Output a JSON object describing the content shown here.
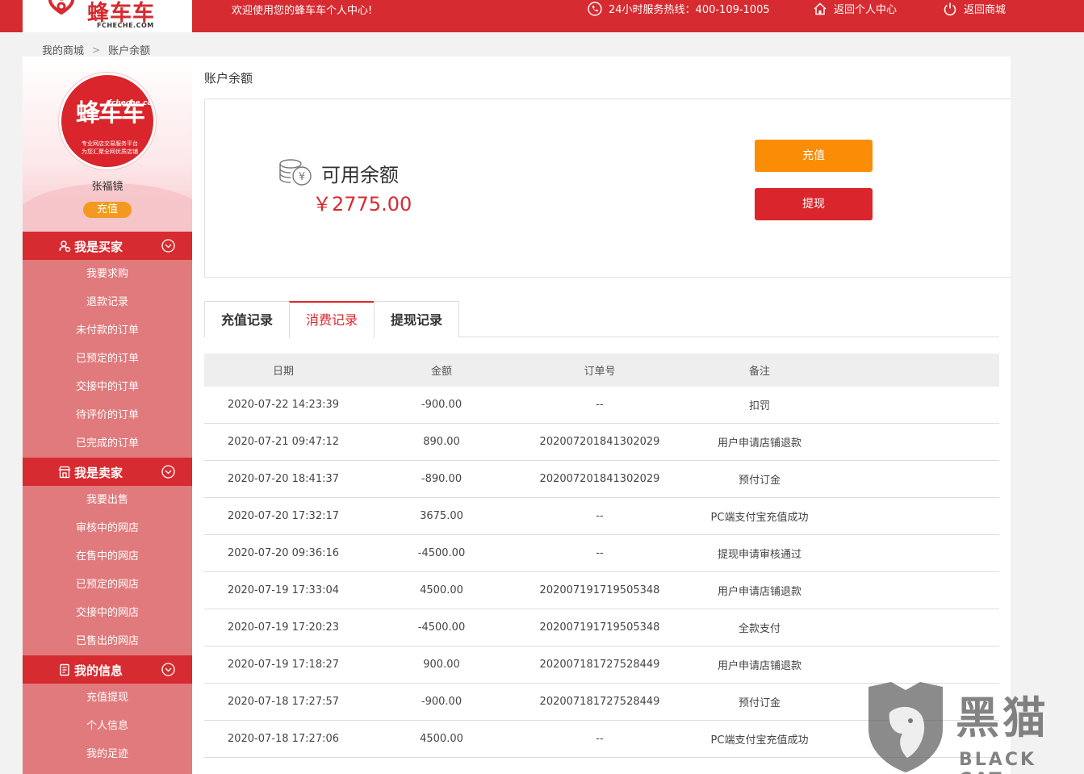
{
  "header": {
    "logo_text": "蜂车车",
    "logo_sub": "FCHECHE.COM",
    "welcome": "欢迎使用您的蜂车车个人中心!",
    "hotline": "24小时服务热线：400-109-1005",
    "back_center": "返回个人中心",
    "back_mall": "返回商城"
  },
  "breadcrumb": {
    "home": "我的商城",
    "separator": ">",
    "current": "账户余额"
  },
  "profile": {
    "avatar_text": "蜂车车",
    "avatar_domain": "fcheche.com",
    "avatar_line1": "专业网店交易服务平台",
    "avatar_line2": "为您汇聚全网优质店铺",
    "username": "张福镜",
    "recharge_label": "充值"
  },
  "sidebar": {
    "sections": [
      {
        "title": "我是买家",
        "items": [
          "我要求购",
          "退款记录",
          "未付款的订单",
          "已预定的订单",
          "交接中的订单",
          "待评价的订单",
          "已完成的订单"
        ]
      },
      {
        "title": "我是卖家",
        "items": [
          "我要出售",
          "审核中的网店",
          "在售中的网店",
          "已预定的网店",
          "交接中的网店",
          "已售出的网店"
        ]
      },
      {
        "title": "我的信息",
        "items": [
          "充值提现",
          "个人信息",
          "我的足迹"
        ]
      }
    ]
  },
  "main": {
    "page_title": "账户余额",
    "balance_label": "可用余额",
    "balance_value": "￥2775.00",
    "recharge_button": "充值",
    "withdraw_button": "提现",
    "tabs": [
      "充值记录",
      "消费记录",
      "提现记录"
    ],
    "active_tab": "消费记录",
    "columns": [
      "日期",
      "金额",
      "订单号",
      "备注"
    ],
    "rows": [
      [
        "2020-07-22 14:23:39",
        "-900.00",
        "--",
        "扣罚"
      ],
      [
        "2020-07-21 09:47:12",
        "890.00",
        "202007201841302029",
        "用户申请店铺退款"
      ],
      [
        "2020-07-20 18:41:37",
        "-890.00",
        "202007201841302029",
        "预付订金"
      ],
      [
        "2020-07-20 17:32:17",
        "3675.00",
        "--",
        "PC端支付宝充值成功"
      ],
      [
        "2020-07-20 09:36:16",
        "-4500.00",
        "--",
        "提现申请审核通过"
      ],
      [
        "2020-07-19 17:33:04",
        "4500.00",
        "202007191719505348",
        "用户申请店铺退款"
      ],
      [
        "2020-07-19 17:20:23",
        "-4500.00",
        "202007191719505348",
        "全款支付"
      ],
      [
        "2020-07-19 17:18:27",
        "900.00",
        "202007181727528449",
        "用户申请店铺退款"
      ],
      [
        "2020-07-18 17:27:57",
        "-900.00",
        "202007181727528449",
        "预付订金"
      ],
      [
        "2020-07-18 17:27:06",
        "4500.00",
        "--",
        "PC端支付宝充值成功"
      ]
    ]
  },
  "watermark": {
    "cn": "黑猫",
    "en": "BLACK CAT"
  },
  "colors": {
    "brand_red": "#d62b30",
    "sidebar_bg": "#e07a7c",
    "orange": "#fb8c05"
  }
}
